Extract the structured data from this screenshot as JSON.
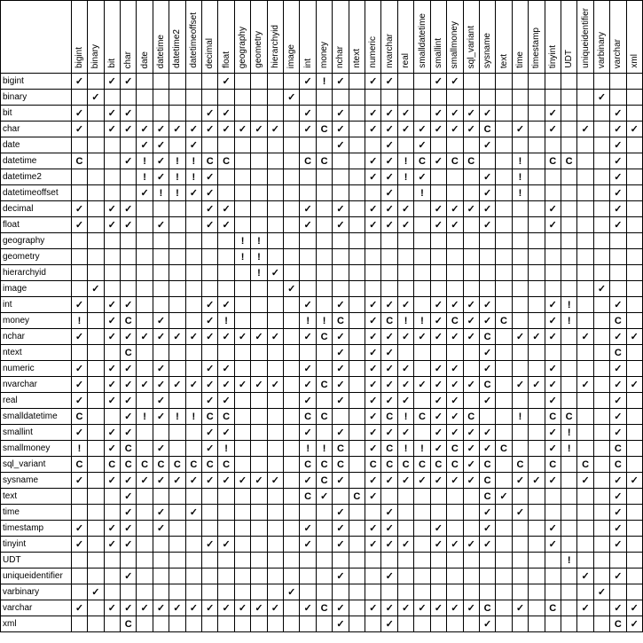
{
  "types": [
    "bigint",
    "binary",
    "bit",
    "char",
    "date",
    "datetime",
    "datetime2",
    "datetimeoffset",
    "decimal",
    "float",
    "geography",
    "geometry",
    "hierarchyid",
    "image",
    "int",
    "money",
    "nchar",
    "ntext",
    "numeric",
    "nvarchar",
    "real",
    "smalldatetime",
    "smallint",
    "smallmoney",
    "sql_variant",
    "sysname",
    "text",
    "time",
    "timestamp",
    "tinyint",
    "UDT",
    "uniqueidentifier",
    "varbinary",
    "varchar",
    "xml"
  ],
  "symbols": {
    "c": "✓",
    "b": "!",
    "e": "C"
  },
  "matrix": [
    "c.cc.....c....cbc.cc..cc......... .",
    ".c...........c..................c..",
    "c.cc....cc....c.c.ccc.cccc...c...c.",
    "c.ccccccccccc.cec.ccccccce.c.c.c.cc",
    "....cc.c........c..c.c...c.......c.",
    "e..cbcbbee....ee..ccbecee..b.ee..c.",
    "....bcbbc.........ccbc...c.b.....c.",
    "....cbbcc..........c.b...c.b.....c.",
    "c.cc....cc....c.c.ccc.cccc...c...c.",
    "c.cc.c..cc....c.c.ccc.cc.c...c...c.",
    "..........bb.......................",
    "..........bb.......................",
    "...........bc......................",
    ".c...........c..................c..",
    "c.cc....cc....c.c.ccc.cccc...cb..c.",
    "b.ce.c..cb....bbe.cebbcecce..cb..e.",
    "c.ccccccccccc.cec.ccccccce.ccc.c.cc",
    "...e............c.cc.....c.......e.",
    "c.cc.c..cc....c.c.ccc.cc.c...c...c.",
    "c.ccccccccccc.cec.ccccccce.ccc.c.cc",
    "c.cc.c..cc....c.c.ccc.cc.c...c...c.",
    "e..cbcbbee....ee..cebecce..b.ee..c.",
    "c.cc....cc....c.c.ccc.cccc...cb..c.",
    "b.ce.c..cb....bbe.cebbcecce..cb..e.",
    "e.eeeeeeee....eee.eeeeeece.e.e.e.e.",
    "c.ccccccccccc.cec.ccccccce.ccc.c.cc",
    "...c..........ec.ec......ec......c.",
    "...c.c.c........c..c.....c.c.....c.",
    "c.cc.c........c.c.cc..c..c...c...c.",
    "c.cc....cc....c.c.ccc.cccc...c...c.",
    "..............................b....",
    "...c............c..c......... .c.c.",
    ".c...........c..................c..",
    "c.ccccccccccc.cec.ccccccce.c.e.c.cc",
    "...e............c..c.....c.......ec"
  ]
}
